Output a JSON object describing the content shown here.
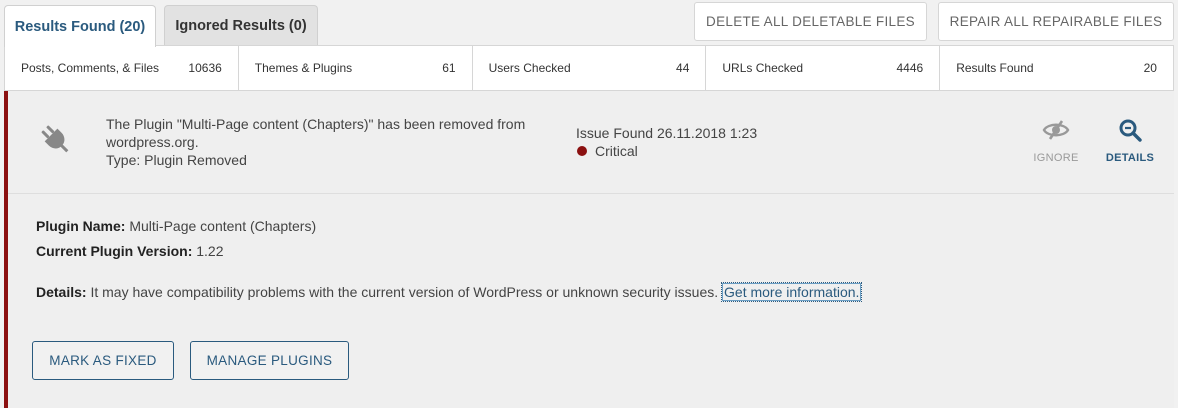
{
  "tabs": [
    {
      "label": "Results Found (20)",
      "active": true
    },
    {
      "label": "Ignored Results (0)",
      "active": false
    }
  ],
  "top_buttons": {
    "delete": "DELETE ALL DELETABLE FILES",
    "repair": "REPAIR ALL REPAIRABLE FILES"
  },
  "stats": [
    {
      "label": "Posts, Comments, & Files",
      "value": "10636"
    },
    {
      "label": "Themes & Plugins",
      "value": "61"
    },
    {
      "label": "Users Checked",
      "value": "44"
    },
    {
      "label": "URLs Checked",
      "value": "4446"
    },
    {
      "label": "Results Found",
      "value": "20"
    }
  ],
  "issue": {
    "icon": "plug-icon",
    "message": "The Plugin \"Multi-Page content (Chapters)\" has been removed from wordpress.org.",
    "type": "Type: Plugin Removed",
    "found": "Issue Found 26.11.2018 1:23",
    "severity": "Critical",
    "severity_color": "#8b1010",
    "actions": {
      "ignore": "IGNORE",
      "details": "DETAILS"
    },
    "plugin_name_label": "Plugin Name:",
    "plugin_name": "Multi-Page content (Chapters)",
    "version_label": "Current Plugin Version:",
    "version": "1.22",
    "details_label": "Details:",
    "details_text": "It may have compatibility problems with the current version of WordPress or unknown security issues.",
    "details_link": "Get more information.",
    "buttons": {
      "fixed": "MARK AS FIXED",
      "manage": "MANAGE PLUGINS"
    }
  },
  "colors": {
    "accent": "#2a5a7e",
    "critical": "#8b1010"
  }
}
